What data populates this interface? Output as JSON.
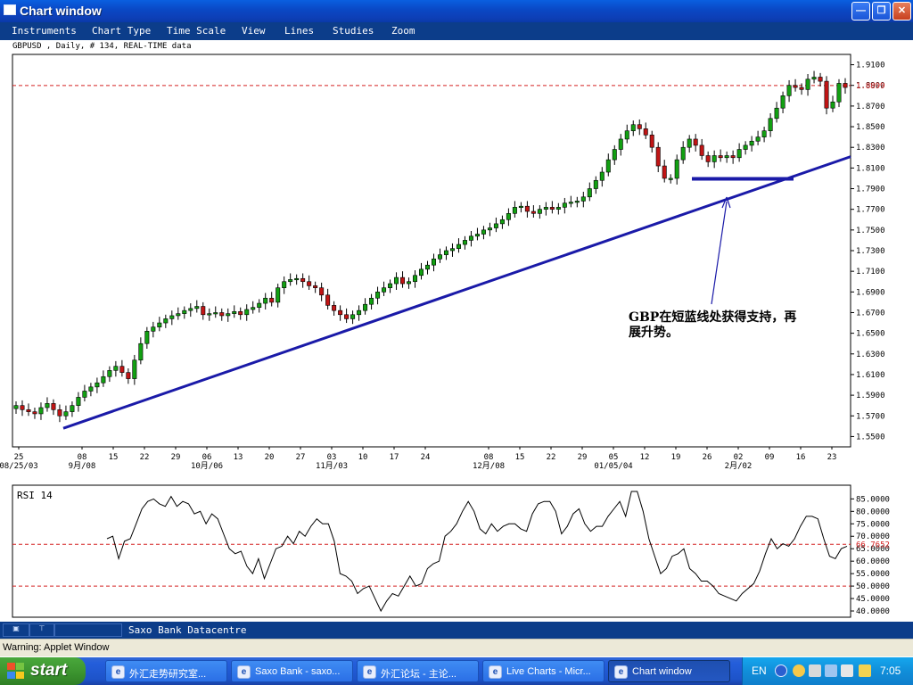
{
  "window": {
    "title": "Chart window"
  },
  "menu": [
    "Instruments",
    "Chart Type",
    "Time Scale",
    "View",
    "Lines",
    "Studies",
    "Zoom"
  ],
  "chart_info": "GBPUSD , Daily, # 134, REAL-TIME data",
  "colors": {
    "up": "#12a012",
    "down": "#c01515",
    "trendline": "#1a1aa8",
    "refline": "#d42020",
    "menu_bg": "#0c3d8a"
  },
  "annotation": {
    "line1": "GBP在短蓝线处获得支持，再",
    "line2": "展升势。"
  },
  "rsi_label": "RSI 14",
  "status": {
    "source": "Saxo Bank Datacentre",
    "warning": "Warning: Applet Window"
  },
  "taskbar": {
    "start": "start",
    "tasks": [
      "外汇走势研究室...",
      "Saxo Bank - saxo...",
      "外汇论坛 - 主论...",
      "Live Charts - Micr...",
      "Chart window"
    ],
    "lang": "EN",
    "clock": "7:05"
  },
  "chart_data": [
    {
      "type": "candlestick",
      "instrument": "GBPUSD",
      "interval": "Daily",
      "ylim": [
        1.54,
        1.92
      ],
      "y_ticks": [
        "1.9100",
        "1.8900",
        "1.8700",
        "1.8500",
        "1.8300",
        "1.8100",
        "1.7900",
        "1.7700",
        "1.7500",
        "1.7300",
        "1.7100",
        "1.6900",
        "1.6700",
        "1.6500",
        "1.6300",
        "1.6100",
        "1.5900",
        "1.5700",
        "1.5500"
      ],
      "reference_line": {
        "value": 1.8899,
        "label": "1.8899"
      },
      "x_ticks": [
        "25",
        "08",
        "15",
        "22",
        "29",
        "06",
        "13",
        "20",
        "27",
        "03",
        "10",
        "17",
        "24",
        "08",
        "15",
        "22",
        "29",
        "05",
        "12",
        "19",
        "26",
        "02",
        "09",
        "16",
        "23"
      ],
      "x_sublabels": [
        "08/25/03",
        "9月/08",
        "10月/06",
        "11月/03",
        "12月/08",
        "01/05/04",
        "2月/02"
      ],
      "closes": [
        1.58,
        1.576,
        1.574,
        1.572,
        1.578,
        1.582,
        1.576,
        1.57,
        1.574,
        1.58,
        1.588,
        1.594,
        1.598,
        1.602,
        1.608,
        1.614,
        1.618,
        1.612,
        1.606,
        1.624,
        1.64,
        1.652,
        1.656,
        1.66,
        1.664,
        1.667,
        1.669,
        1.672,
        1.674,
        1.676,
        1.668,
        1.669,
        1.67,
        1.667,
        1.669,
        1.671,
        1.668,
        1.673,
        1.675,
        1.679,
        1.684,
        1.68,
        1.694,
        1.7,
        1.702,
        1.703,
        1.7,
        1.696,
        1.694,
        1.687,
        1.677,
        1.672,
        1.668,
        1.664,
        1.668,
        1.672,
        1.678,
        1.684,
        1.69,
        1.694,
        1.698,
        1.704,
        1.698,
        1.7,
        1.706,
        1.712,
        1.716,
        1.722,
        1.726,
        1.73,
        1.732,
        1.736,
        1.74,
        1.744,
        1.746,
        1.75,
        1.752,
        1.756,
        1.76,
        1.766,
        1.772,
        1.773,
        1.768,
        1.766,
        1.77,
        1.772,
        1.77,
        1.772,
        1.776,
        1.777,
        1.778,
        1.782,
        1.79,
        1.798,
        1.806,
        1.818,
        1.828,
        1.838,
        1.846,
        1.852,
        1.848,
        1.842,
        1.83,
        1.812,
        1.8,
        1.8,
        1.818,
        1.83,
        1.838,
        1.832,
        1.822,
        1.816,
        1.822,
        1.82,
        1.822,
        1.82,
        1.828,
        1.832,
        1.836,
        1.84,
        1.846,
        1.858,
        1.868,
        1.88,
        1.89,
        1.888,
        1.886,
        1.896,
        1.898,
        1.894,
        1.868,
        1.874,
        1.892,
        1.888
      ],
      "trendline": {
        "from": [
          "08/25/03",
          1.558
        ],
        "to": [
          "23",
          1.821
        ]
      },
      "support_line": {
        "value": 1.7995,
        "label": "short blue line"
      }
    },
    {
      "type": "line",
      "title": "RSI 14",
      "ylim": [
        37.5,
        90.5
      ],
      "y_ticks": [
        "85.0000",
        "80.0000",
        "75.0000",
        "70.0000",
        "65.0000",
        "60.0000",
        "55.0000",
        "50.0000",
        "45.0000",
        "40.0000"
      ],
      "reference_lines": [
        {
          "value": 66.7652,
          "label": "66.7652"
        },
        {
          "value": 50,
          "label": ""
        }
      ],
      "values": [
        69,
        70,
        61,
        68,
        69,
        75,
        81,
        84,
        85,
        83,
        82,
        86,
        82,
        84,
        83,
        79,
        80,
        75,
        79,
        77,
        71,
        65,
        63,
        64,
        58,
        55,
        61,
        53,
        59,
        65,
        66,
        70,
        67,
        72,
        70,
        74,
        77,
        75,
        75,
        68,
        55,
        54,
        52,
        47,
        49,
        50,
        45,
        40,
        44,
        47,
        46,
        50,
        54,
        50,
        51,
        57,
        59,
        60,
        70,
        72,
        75,
        80,
        84,
        80,
        73,
        71,
        75,
        72,
        74,
        75,
        75,
        73,
        72,
        79,
        83,
        84,
        84,
        80,
        71,
        74,
        79,
        81,
        75,
        72,
        74,
        74,
        78,
        81,
        84,
        78,
        88,
        88,
        80,
        69,
        62,
        55,
        57,
        62,
        63,
        65,
        57,
        55,
        52,
        52,
        50,
        47,
        46,
        45,
        44,
        47,
        49,
        51,
        56,
        63,
        69,
        65,
        67,
        66,
        69,
        74,
        78,
        78,
        77,
        69,
        62,
        61,
        65,
        66
      ]
    }
  ]
}
